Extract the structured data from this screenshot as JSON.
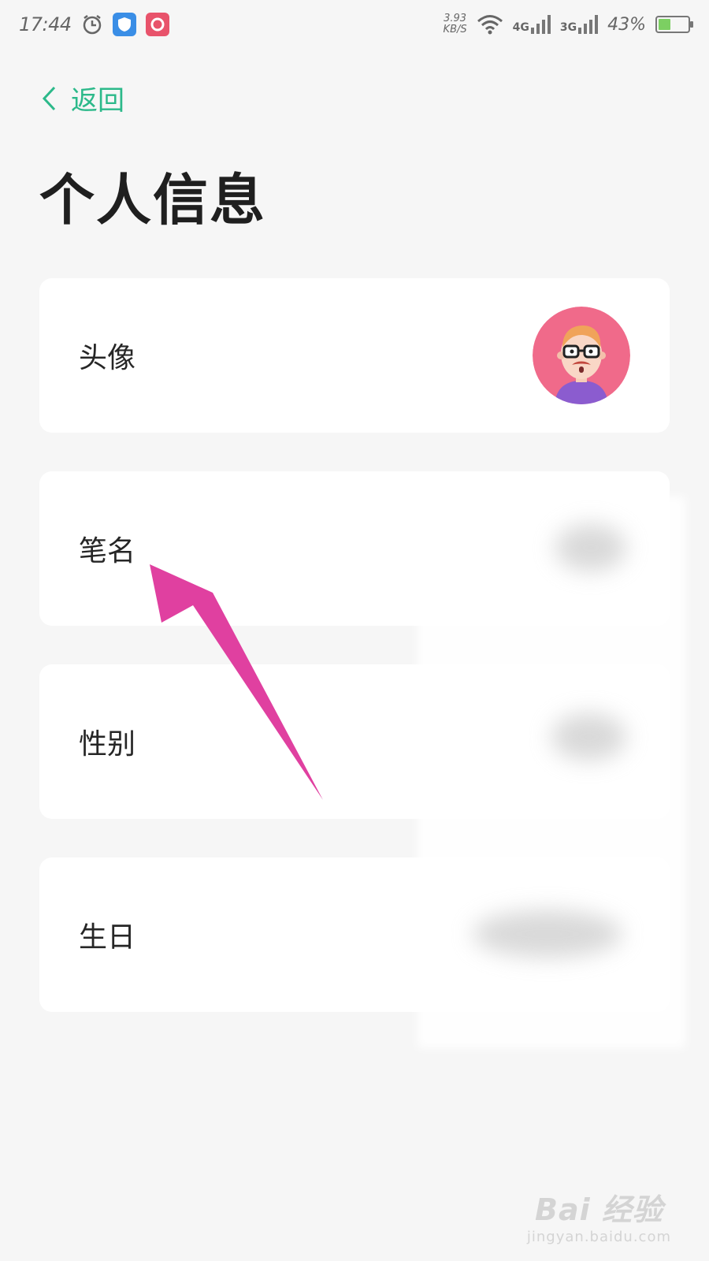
{
  "status_bar": {
    "time": "17:44",
    "speed_value": "3.93",
    "speed_unit": "KB/S",
    "network_1": "4G",
    "network_2": "3G",
    "battery_percent": "43%",
    "battery_level": 0.43,
    "icons": [
      "alarm-icon",
      "shield-app-icon",
      "camera-app-icon",
      "wifi-icon",
      "signal-icon",
      "battery-icon"
    ]
  },
  "nav": {
    "back_label": "返回",
    "accent_color": "#2cb98a"
  },
  "page": {
    "title": "个人信息"
  },
  "rows": [
    {
      "label": "头像",
      "value_type": "avatar"
    },
    {
      "label": "笔名",
      "value_type": "blurred"
    },
    {
      "label": "性别",
      "value_type": "blurred"
    },
    {
      "label": "生日",
      "value_type": "blurred"
    }
  ],
  "annotation": {
    "arrow_color": "#e040a0"
  },
  "watermark": {
    "brand": "Bai 经验",
    "url": "jingyan.baidu.com"
  }
}
